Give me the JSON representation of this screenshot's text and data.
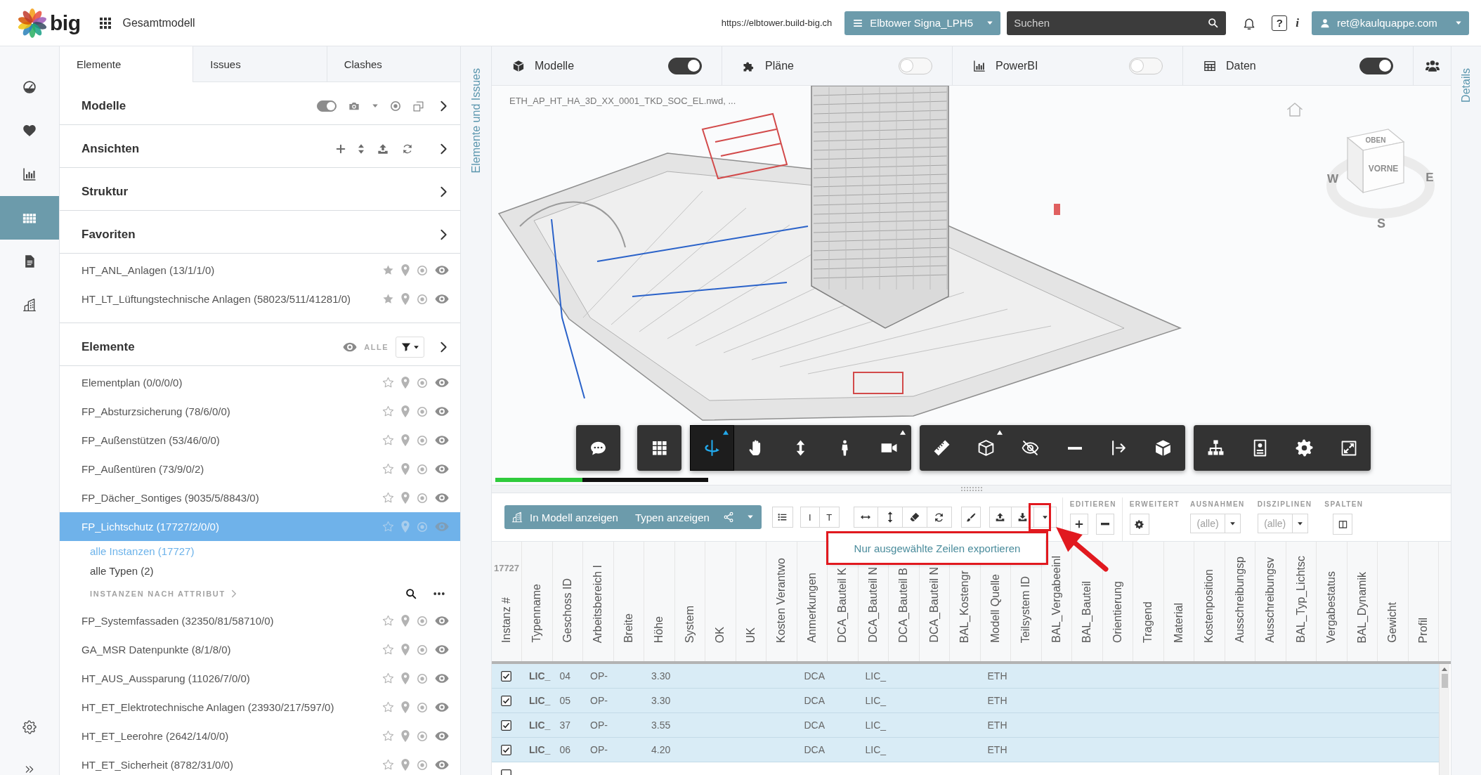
{
  "topbar": {
    "logo_text": "big",
    "app_title": "Gesamtmodell",
    "url": "https://elbtower.build-big.ch",
    "project": "Elbtower Signa_LPH5",
    "search": {
      "placeholder": "Suchen"
    },
    "help_label": "?",
    "info_label": "i",
    "user": "ret@kaulquappe.com"
  },
  "rail": [
    {
      "selected": false
    },
    {
      "selected": false
    },
    {
      "selected": false
    },
    {
      "selected": true
    },
    {
      "selected": false
    },
    {
      "selected": false
    }
  ],
  "left_panel": {
    "tabs": [
      {
        "label": "Elemente",
        "selected": true
      },
      {
        "label": "Issues",
        "selected": false
      },
      {
        "label": "Clashes",
        "selected": false
      }
    ],
    "sections": [
      {
        "kind": "models",
        "title": "Modelle",
        "toggle_on": true
      },
      {
        "kind": "views",
        "title": "Ansichten"
      },
      {
        "kind": "plain",
        "title": "Struktur"
      },
      {
        "kind": "plain",
        "title": "Favoriten",
        "items": [
          {
            "label": "HT_ANL_Anlagen (13/1/1/0)",
            "favorite": true,
            "selected": false
          },
          {
            "label": "HT_LT_Lüftungstechnische Anlagen (58023/511/41281/0)",
            "favorite": true,
            "selected": false
          }
        ]
      },
      {
        "kind": "filter",
        "title": "Elemente",
        "filter_label": "ALLE",
        "items": [
          {
            "label": "Elementplan (0/0/0/0)",
            "favorite": false,
            "selected": false
          },
          {
            "label": "FP_Absturzsicherung (78/6/0/0)",
            "favorite": false,
            "selected": false
          },
          {
            "label": "FP_Außenstützen (53/46/0/0)",
            "favorite": false,
            "selected": false
          },
          {
            "label": "FP_Außentüren (73/9/0/2)",
            "favorite": false,
            "selected": false
          },
          {
            "label": "FP_Dächer_Sontiges (9035/5/8843/0)",
            "favorite": false,
            "selected": false
          },
          {
            "label": "FP_Lichtschutz (17727/2/0/0)",
            "favorite": false,
            "selected": true,
            "children": [
              {
                "label": "alle Instanzen (17727)",
                "selected": true
              },
              {
                "label": "alle Typen (2)",
                "selected": false
              }
            ],
            "attribute_header": "INSTANZEN NACH ATTRIBUT"
          },
          {
            "label": "FP_Systemfassaden (32350/81/58710/0)",
            "favorite": false,
            "selected": false
          },
          {
            "label": "GA_MSR Datenpunkte (8/1/8/0)",
            "favorite": false,
            "selected": false
          },
          {
            "label": "HT_AUS_Aussparung (11026/7/0/0)",
            "favorite": false,
            "selected": false
          },
          {
            "label": "HT_ET_Elektrotechnische Anlagen (23930/217/597/0)",
            "favorite": false,
            "selected": false
          },
          {
            "label": "HT_ET_Leerohre (2642/14/0/0)",
            "favorite": false,
            "selected": false
          },
          {
            "label": "HT_ET_Sicherheit (8782/31/0/0)",
            "favorite": false,
            "selected": false
          }
        ]
      }
    ]
  },
  "side_labels": {
    "left": "Elemente und Issues",
    "right": "Details"
  },
  "viewer": {
    "tabs": [
      {
        "label": "Modelle",
        "on": true
      },
      {
        "label": "Pläne",
        "on": false
      },
      {
        "label": "PowerBI",
        "on": false
      },
      {
        "label": "Daten",
        "on": true
      }
    ],
    "file_name": "ETH_AP_HT_HA_3D_XX_0001_TKD_SOC_EL.nwd, ...",
    "viewcube": {
      "top": "OBEN",
      "front": "VORNE",
      "west": "W",
      "east": "E",
      "south": "S"
    },
    "toolbar": [
      {
        "tools": [
          {
            "selected": false,
            "menu": false
          }
        ]
      },
      {
        "tools": [
          {
            "selected": false,
            "menu": false
          }
        ]
      },
      {
        "tools": [
          {
            "selected": true,
            "menu": true
          },
          {
            "selected": false,
            "menu": false
          },
          {
            "selected": false,
            "menu": false
          },
          {
            "selected": false,
            "menu": false
          },
          {
            "selected": false,
            "menu": true
          }
        ]
      },
      {
        "tools": [
          {
            "selected": false,
            "menu": false
          },
          {
            "selected": false,
            "menu": true
          },
          {
            "selected": false,
            "menu": false
          },
          {
            "selected": false,
            "menu": false
          },
          {
            "selected": false,
            "menu": false
          },
          {
            "selected": false,
            "menu": false
          }
        ]
      },
      {
        "tools": [
          {
            "selected": false,
            "menu": false
          },
          {
            "selected": false,
            "menu": false
          },
          {
            "selected": false,
            "menu": false
          },
          {
            "selected": false,
            "menu": false
          }
        ]
      }
    ],
    "progress": {
      "level": 0.41
    }
  },
  "table_toolbar": {
    "model_button": "In Modell anzeigen",
    "types_button": "Typen anzeigen",
    "text_buttons": [
      "I",
      "T"
    ],
    "export_menu": {
      "items": [
        "Nur ausgewählte Zeilen exportieren"
      ]
    },
    "edit_label": "EDITIEREN",
    "advanced_label": "ERWEITERT",
    "filters": [
      {
        "label": "AUSNAHMEN",
        "value": "(alle)"
      },
      {
        "label": "DISZIPLINEN",
        "value": "(alle)"
      }
    ],
    "columns_label": "SPALTEN"
  },
  "table": {
    "count": "17727",
    "columns": [
      "Instanz #",
      "Typenname",
      "Geschoss ID",
      "Arbeitsbereich I",
      "Breite",
      "Höhe",
      "System",
      "OK",
      "UK",
      "Kosten Verantwo",
      "Anmerkungen",
      "DCA_Bauteil K",
      "DCA_Bauteil N",
      "DCA_Bauteil B",
      "DCA_Bauteil N",
      "BAL_Kostengr",
      "Modell Quelle",
      "Teilsystem ID",
      "BAL_Vergabeeinl",
      "BAL_Bauteil",
      "Orientierung",
      "Tragend",
      "Material",
      "Kostenposition",
      "Ausschreibungsp",
      "Ausschreibungsv",
      "BAL_Typ_Lichtsc",
      "Vergabestatus",
      "BAL_Dynamik",
      "Gewicht",
      "Profil"
    ],
    "rows": [
      {
        "checked": true,
        "cells": [
          null,
          "LIC_",
          "04",
          "OP-",
          null,
          "3.30",
          null,
          null,
          null,
          null,
          "DCA",
          null,
          "LIC_",
          null,
          null,
          null,
          "ETH"
        ]
      },
      {
        "checked": true,
        "cells": [
          null,
          "LIC_",
          "05",
          "OP-",
          null,
          "3.30",
          null,
          null,
          null,
          null,
          "DCA",
          null,
          "LIC_",
          null,
          null,
          null,
          "ETH"
        ]
      },
      {
        "checked": true,
        "cells": [
          null,
          "LIC_",
          "37",
          "OP-",
          null,
          "3.55",
          null,
          null,
          null,
          null,
          "DCA",
          null,
          "LIC_",
          null,
          null,
          null,
          "ETH"
        ]
      },
      {
        "checked": true,
        "cells": [
          null,
          "LIC_",
          "06",
          "OP-",
          null,
          "4.20",
          null,
          null,
          null,
          null,
          "DCA",
          null,
          "LIC_",
          null,
          null,
          null,
          "ETH"
        ]
      },
      {
        "checked": false
      }
    ]
  }
}
